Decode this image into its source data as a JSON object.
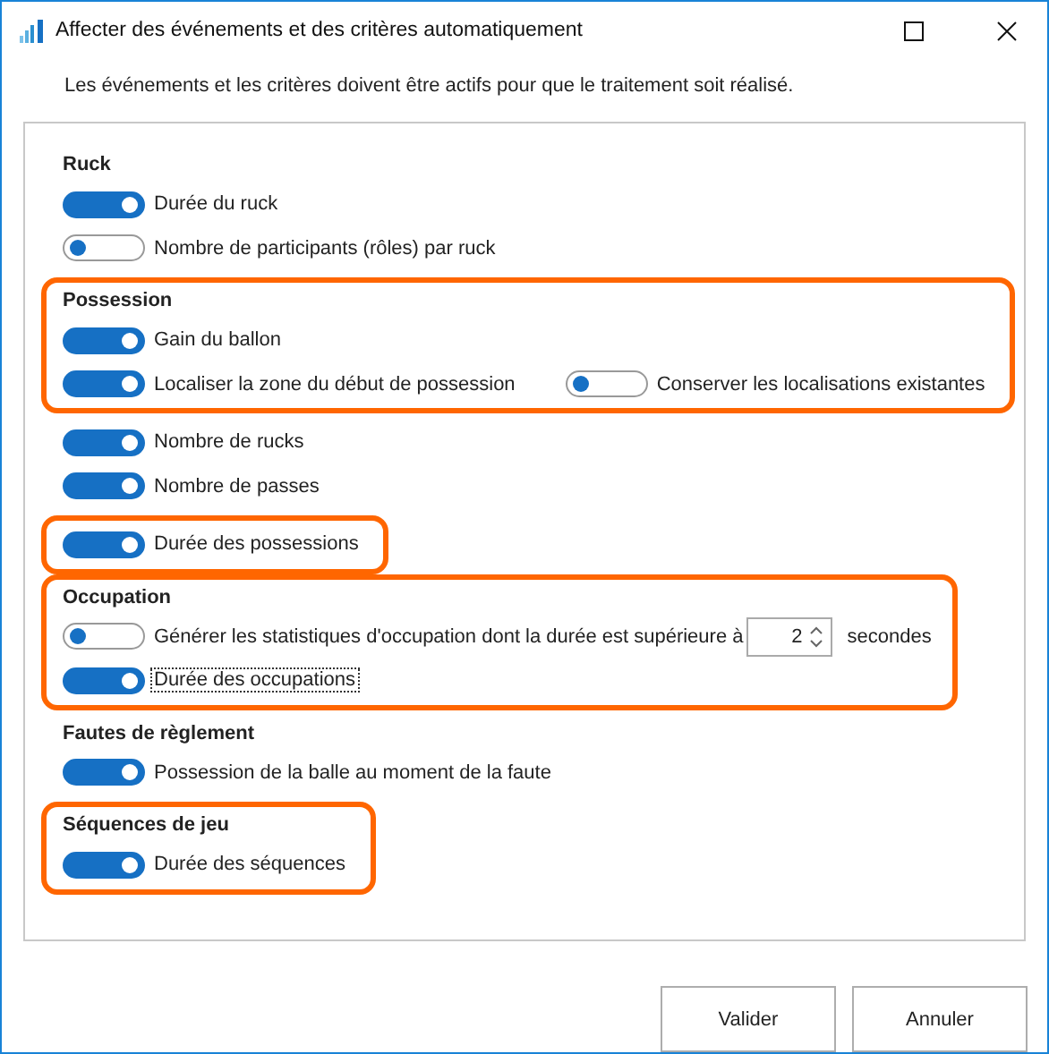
{
  "window": {
    "title": "Affecter des événements et des critères automatiquement"
  },
  "message": "Les événements et les critères doivent être actifs pour que le traitement soit réalisé.",
  "blocks": [
    {
      "highlighted": false,
      "title": "Ruck",
      "rows": [
        [
          {
            "kind": "toggle",
            "label": "Durée du ruck",
            "on": true,
            "focused": false
          }
        ],
        [
          {
            "kind": "toggle",
            "label": "Nombre de participants (rôles) par ruck",
            "on": false,
            "focused": false
          }
        ]
      ]
    },
    {
      "highlighted": true,
      "title": "Possession",
      "rows": [
        [
          {
            "kind": "toggle",
            "label": "Gain du ballon",
            "on": true,
            "focused": false
          }
        ],
        [
          {
            "kind": "toggle",
            "label": "Localiser la zone du début de possession",
            "on": true,
            "focused": false
          },
          {
            "kind": "toggle",
            "label": "Conserver les localisations existantes",
            "on": false,
            "focused": false
          }
        ]
      ]
    },
    {
      "highlighted": false,
      "rows": [
        [
          {
            "kind": "toggle",
            "label": "Nombre de rucks",
            "on": true,
            "focused": false
          }
        ],
        [
          {
            "kind": "toggle",
            "label": "Nombre de passes",
            "on": true,
            "focused": false
          }
        ]
      ]
    },
    {
      "highlighted": true,
      "rows": [
        [
          {
            "kind": "toggle",
            "label": "Durée des possessions",
            "on": true,
            "focused": false
          }
        ]
      ]
    },
    {
      "highlighted": true,
      "title": "Occupation",
      "rows": [
        [
          {
            "kind": "toggle",
            "label": "Générer les statistiques d'occupation dont la durée est supérieure à",
            "on": false,
            "focused": false
          },
          {
            "kind": "spinner",
            "value": "2"
          },
          {
            "kind": "text",
            "label": "secondes"
          }
        ],
        [
          {
            "kind": "toggle",
            "label": "Durée des occupations",
            "on": true,
            "focused": true
          }
        ]
      ]
    },
    {
      "highlighted": false,
      "title": "Fautes de règlement",
      "rows": [
        [
          {
            "kind": "toggle",
            "label": "Possession de la balle au moment de la faute",
            "on": true,
            "focused": false
          }
        ]
      ]
    },
    {
      "highlighted": true,
      "title": "Séquences de jeu",
      "rows": [
        [
          {
            "kind": "toggle",
            "label": "Durée des séquences",
            "on": true,
            "focused": false
          }
        ]
      ]
    }
  ],
  "buttons": [
    "Valider",
    "Annuler"
  ]
}
